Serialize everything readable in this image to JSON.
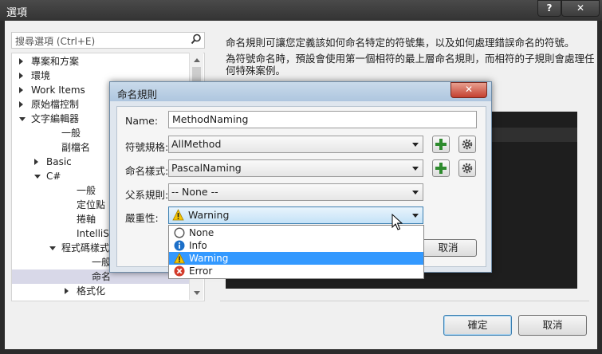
{
  "window": {
    "title": "選項",
    "help_label": "?",
    "close_label": "✕"
  },
  "search": {
    "placeholder": "搜尋選項 (Ctrl+E)",
    "icon": "search-icon"
  },
  "tree": [
    {
      "label": "專案和方案",
      "level": 0,
      "expander": "collapsed"
    },
    {
      "label": "環境",
      "level": 0,
      "expander": "collapsed"
    },
    {
      "label": "Work Items",
      "level": 0,
      "expander": "collapsed"
    },
    {
      "label": "原始檔控制",
      "level": 0,
      "expander": "collapsed"
    },
    {
      "label": "文字編輯器",
      "level": 0,
      "expander": "expanded"
    },
    {
      "label": "一般",
      "level": 2,
      "expander": "none"
    },
    {
      "label": "副檔名",
      "level": 2,
      "expander": "none"
    },
    {
      "label": "Basic",
      "level": 1,
      "expander": "collapsed"
    },
    {
      "label": "C#",
      "level": 1,
      "expander": "expanded"
    },
    {
      "label": "一般",
      "level": 3,
      "expander": "none"
    },
    {
      "label": "定位點",
      "level": 3,
      "expander": "none"
    },
    {
      "label": "捲軸",
      "level": 3,
      "expander": "none"
    },
    {
      "label": "IntelliSense",
      "level": 3,
      "expander": "none"
    },
    {
      "label": "程式碼樣式",
      "level": 2,
      "expander": "expanded"
    },
    {
      "label": "一般",
      "level": 4,
      "expander": "none"
    },
    {
      "label": "命名",
      "level": 4,
      "expander": "none",
      "selected": true
    },
    {
      "label": "格式化",
      "level": 3,
      "expander": "collapsed"
    }
  ],
  "description": {
    "line1": "命名規則可讓您定義該如何命名特定的符號集，以及如何處理錯誤命名的符號。",
    "line2": "為符號命名時，預設會使用第一個相符的最上層命名規則，而相符的子規則會處理任",
    "line3": "何特殊案例。"
  },
  "footer": {
    "ok_label": "確定",
    "cancel_label": "取消"
  },
  "naming_dialog": {
    "title": "命名規則",
    "close_label": "✕",
    "name_label": "Name:",
    "name_value": "MethodNaming",
    "symbol_spec_label": "符號規格:",
    "symbol_spec_value": "AllMethod",
    "naming_style_label": "命名樣式:",
    "naming_style_value": "PascalNaming",
    "parent_rule_label": "父系規則:",
    "parent_rule_value": "-- None --",
    "severity_label": "嚴重性:",
    "severity_value": "Warning",
    "cancel_label": "取消",
    "severity_options": [
      {
        "label": "None",
        "icon": "circle-outline-icon"
      },
      {
        "label": "Info",
        "icon": "info-icon"
      },
      {
        "label": "Warning",
        "icon": "warning-icon",
        "highlighted": true
      },
      {
        "label": "Error",
        "icon": "error-icon"
      }
    ]
  }
}
